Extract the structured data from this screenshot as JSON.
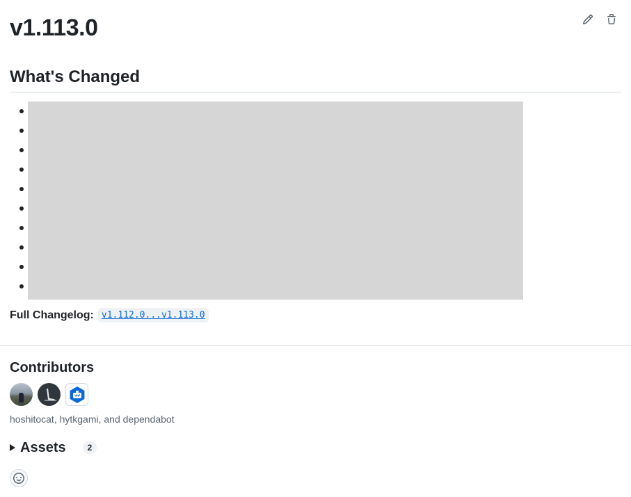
{
  "release": {
    "title": "v1.113.0"
  },
  "actions": {
    "edit_icon": "pencil-icon",
    "delete_icon": "trash-icon"
  },
  "whats_changed": {
    "heading": "What's Changed",
    "items_count": 10
  },
  "changelog": {
    "label": "Full Changelog:",
    "link_text": "v1.112.0...v1.113.0"
  },
  "contributors": {
    "heading": "Contributors",
    "names": "hoshitocat, hytkgami, and dependabot"
  },
  "assets": {
    "label": "Assets",
    "count": "2"
  },
  "colors": {
    "accent_link": "#0969da",
    "text": "#1f2328",
    "muted": "#59636e",
    "border": "#d1d9e0",
    "redaction": "#d6d6d6"
  }
}
